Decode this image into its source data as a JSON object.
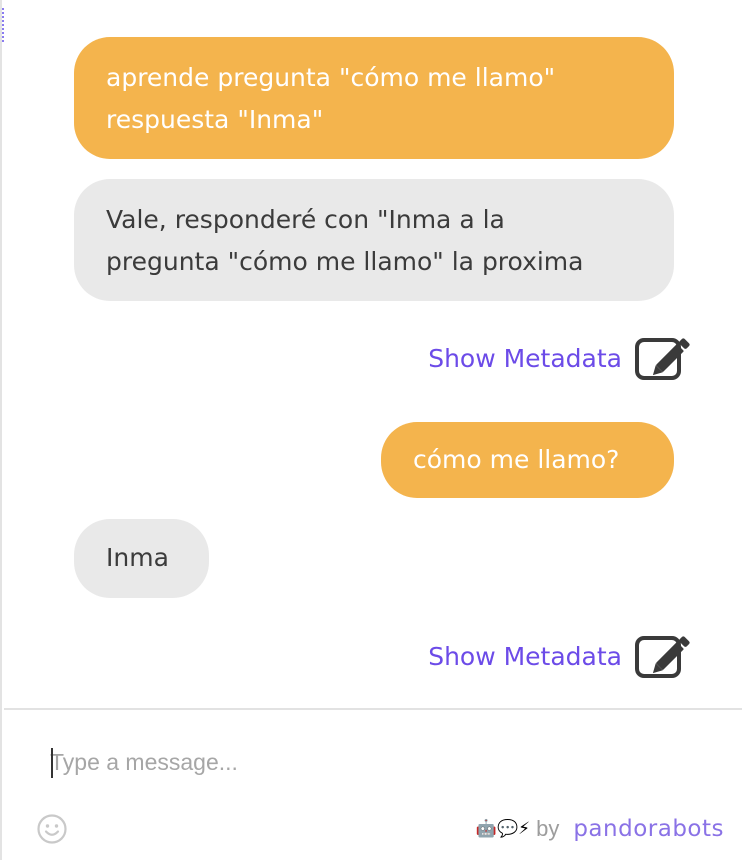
{
  "messages": [
    {
      "sender": "user",
      "lines": [
        "aprende pregunta \"cómo me llamo\"",
        "respuesta \"Inma\""
      ]
    },
    {
      "sender": "bot",
      "lines": [
        "Vale, responderé con \"Inma a la",
        "pregunta \"cómo me llamo\" la proxima"
      ]
    },
    {
      "sender": "user",
      "lines": [
        "cómo me llamo?"
      ]
    },
    {
      "sender": "bot",
      "lines": [
        "Inma"
      ]
    }
  ],
  "metadata_links": [
    {
      "label": "Show Metadata",
      "icon": "edit-icon"
    },
    {
      "label": "Show Metadata",
      "icon": "edit-icon"
    }
  ],
  "composer": {
    "placeholder": "Type a message...",
    "emoji_icon": "smiley-icon"
  },
  "branding": {
    "emojis": [
      "🤖",
      "💬",
      "⚡"
    ],
    "by_label": "by",
    "name": "pandorabots"
  },
  "colors": {
    "user_bubble": "#f4b44d",
    "bot_bubble": "#e9e9e9",
    "link": "#6c4be8",
    "brand": "#8a72e6"
  }
}
